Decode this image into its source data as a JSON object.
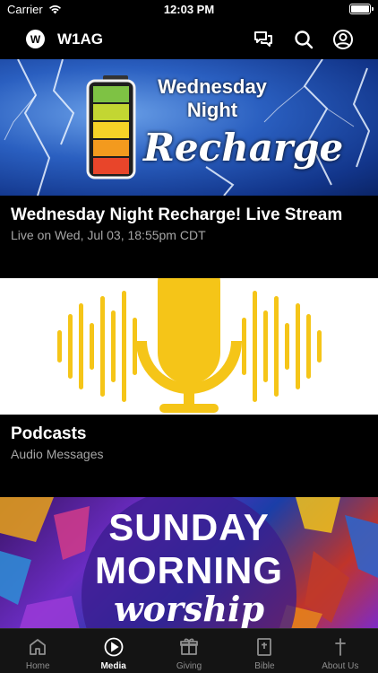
{
  "status_bar": {
    "carrier": "Carrier",
    "time": "12:03 PM"
  },
  "header": {
    "logo_letter": "W",
    "title": "W1AG",
    "icons": [
      "chat-icon",
      "search-icon",
      "account-icon"
    ]
  },
  "media": [
    {
      "image_title_line1": "Wednesday",
      "image_title_line2": "Night",
      "image_title_line3": "Recharge",
      "title": "Wednesday Night Recharge! Live Stream",
      "subtitle": "Live on Wed, Jul 03, 18:55pm CDT"
    },
    {
      "title": "Podcasts",
      "subtitle": "Audio Messages"
    },
    {
      "image_title_line1": "SUNDAY",
      "image_title_line2": "MORNING",
      "image_title_line3": "worship"
    }
  ],
  "tabs": [
    {
      "label": "Home",
      "icon": "home-icon"
    },
    {
      "label": "Media",
      "icon": "play-icon",
      "active": true
    },
    {
      "label": "Giving",
      "icon": "gift-icon"
    },
    {
      "label": "Bible",
      "icon": "bible-icon"
    },
    {
      "label": "About Us",
      "icon": "cross-icon"
    }
  ],
  "colors": {
    "background": "#000000",
    "tabbar": "#141414",
    "accent": "#ffffff",
    "inactive": "#8e8e8e",
    "mic": "#f5c518"
  }
}
